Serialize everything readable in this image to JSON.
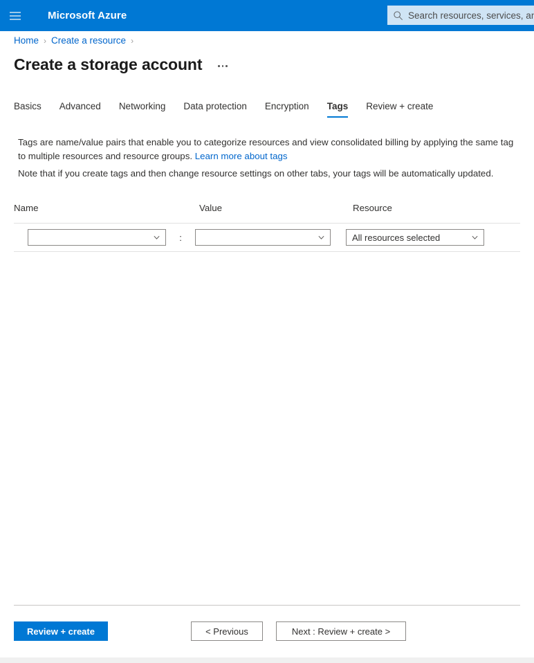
{
  "topbar": {
    "menu_icon": "hamburger-icon",
    "brand": "Microsoft Azure",
    "search_icon": "search-icon",
    "search_placeholder": "Search resources, services, and docs",
    "search_value": "",
    "background_color": "#0078d4"
  },
  "breadcrumb": {
    "items": [
      {
        "label": "Home"
      },
      {
        "label": "Create a resource"
      }
    ],
    "separator": "›",
    "link_color": "#0066cc"
  },
  "page": {
    "title": "Create a storage account",
    "more_menu": "…"
  },
  "tabs": [
    {
      "label": "Basics",
      "active": false
    },
    {
      "label": "Advanced",
      "active": false
    },
    {
      "label": "Networking",
      "active": false
    },
    {
      "label": "Data protection",
      "active": false
    },
    {
      "label": "Encryption",
      "active": false
    },
    {
      "label": "Tags",
      "active": true
    },
    {
      "label": "Review + create",
      "active": false
    }
  ],
  "content": {
    "description_text": "Tags are name/value pairs that enable you to categorize resources and view consolidated billing by applying the same tag to multiple resources and resource groups.",
    "description_link": "Learn more about tags",
    "note_text": "Note that if you create tags and then change resource settings on other tabs, your tags will be automatically updated."
  },
  "tag_table": {
    "headers": {
      "name": "Name",
      "value": "Value",
      "resource": "Resource"
    },
    "separator": ":",
    "rows": [
      {
        "name_value": "",
        "name_placeholder": "",
        "value_value": "",
        "value_placeholder": "",
        "resource_value": "All resources selected"
      }
    ]
  },
  "footer": {
    "primary_button": "Review + create",
    "previous_button": "< Previous",
    "next_button": "Next : Review + create >",
    "primary_color": "#0078d4"
  }
}
